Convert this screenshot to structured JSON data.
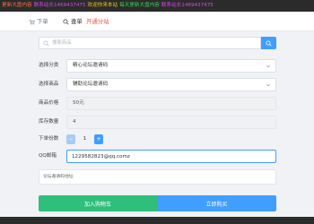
{
  "marquee": [
    {
      "text": "更新大盘内容",
      "color": "#ff7043"
    },
    {
      "text": "联系站长1469437475",
      "color": "#d946ef"
    },
    {
      "text": "欢迎你来本站",
      "color": "#f5c518"
    },
    {
      "text": "每天更新大盘内容",
      "color": "#39d353"
    },
    {
      "text": "联系站长1469437475",
      "color": "#d946ef"
    }
  ],
  "nav": {
    "order_label": "下单",
    "query_label": "查单",
    "sub_label": "开通分站"
  },
  "search": {
    "placeholder": "搜索商品"
  },
  "form": {
    "category_label": "选择分类",
    "category_value": "精心论坛邀请码",
    "product_label": "选择商品",
    "product_value": "辅助论坛邀请码",
    "price_label": "商品价格",
    "price_value": "50元",
    "stock_label": "库存数量",
    "stock_value": "4",
    "qty_label": "下单份数",
    "qty_value": "1",
    "qty_minus": "−",
    "qty_plus": "+",
    "qq_label": "QQ邮箱",
    "qq_value": "1229582823@qq.comz"
  },
  "hint": {
    "text": "论坛邀请码地址"
  },
  "actions": {
    "cart_label": "加入购物车",
    "buy_label": "立即购买"
  },
  "colors": {
    "primary": "#409eff",
    "success": "#2ebf7a",
    "danger": "#e0584f"
  }
}
